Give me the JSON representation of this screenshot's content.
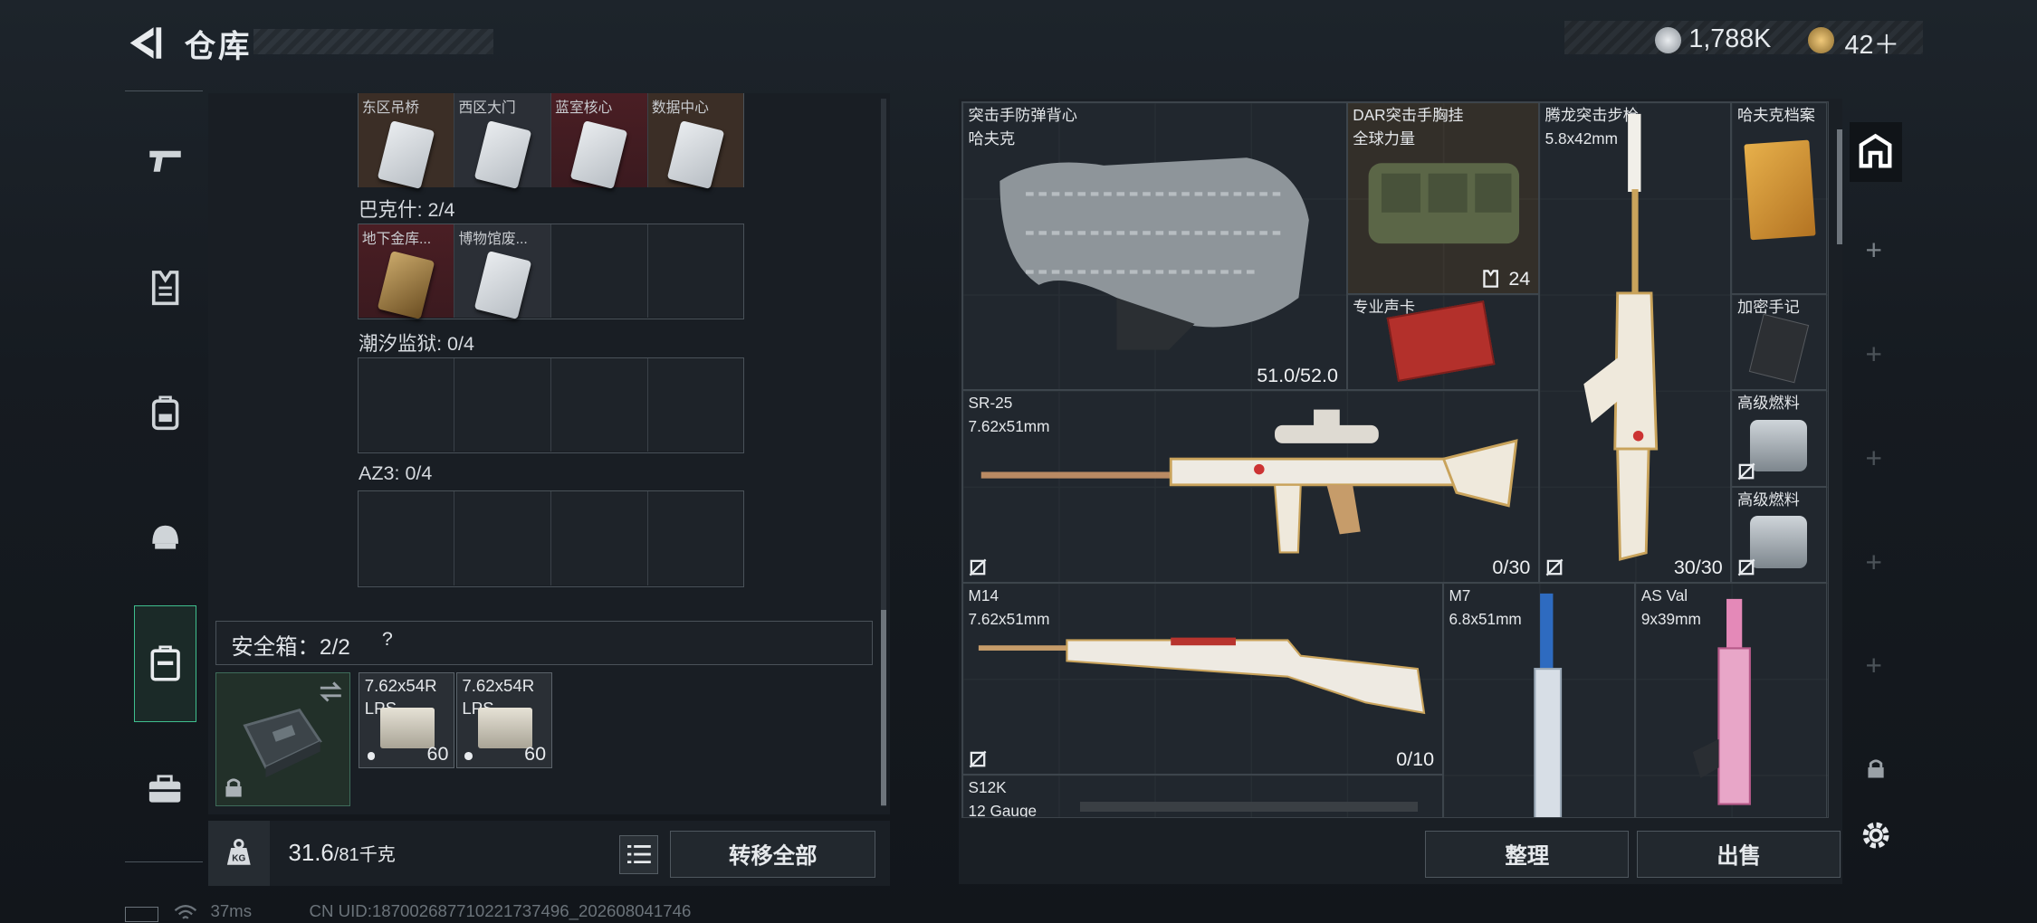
{
  "header": {
    "title": "仓库",
    "currency1": "1,788K",
    "currency2": "42＋"
  },
  "left": {
    "locker_top_row": [
      "东区吊桥",
      "西区大门",
      "蓝室核心",
      "数据中心"
    ],
    "group2_label": "巴克什: 2/4",
    "group2_items": [
      "地下金库...",
      "博物馆废..."
    ],
    "group3_label": "潮汐监狱: 0/4",
    "group4_label": "AZ3: 0/4",
    "safebox_label": "安全箱：2/2",
    "safebox_help": "?",
    "ammo": [
      {
        "name": "7.62x54R",
        "sub": "LPS",
        "count": "60"
      },
      {
        "name": "7.62x54R",
        "sub": "LPS",
        "count": "60"
      }
    ],
    "weight_value": "31.6",
    "weight_limit": "/81千克",
    "transfer_all": "转移全部"
  },
  "stash": {
    "vest": {
      "name": "突击手防弹背心",
      "brand": "哈夫克",
      "durability": "51.0/52.0"
    },
    "rig": {
      "name": "DAR突击手胸挂",
      "brand": "全球力量",
      "count": "24"
    },
    "rifle_tl": {
      "name": "腾龙突击步枪",
      "caliber": "5.8x42mm",
      "ammo": "30/30"
    },
    "havk_file": {
      "name": "哈夫克档案"
    },
    "gpu": {
      "name": "专业声卡"
    },
    "notebook": {
      "name": "加密手记"
    },
    "sr25": {
      "name": "SR-25",
      "caliber": "7.62x51mm",
      "ammo": "0/30"
    },
    "fuel1": {
      "name": "高级燃料"
    },
    "fuel2": {
      "name": "高级燃料"
    },
    "m14": {
      "name": "M14",
      "caliber": "7.62x51mm",
      "ammo": "0/10"
    },
    "m7": {
      "name": "M7",
      "caliber": "6.8x51mm"
    },
    "asval": {
      "name": "AS Val",
      "caliber": "9x39mm"
    },
    "s12k": {
      "name": "S12K",
      "caliber": "12 Gauge"
    },
    "sort_btn": "整理",
    "sell_btn": "出售"
  },
  "footer": {
    "ping": "37ms",
    "uid": "CN UID:18700268771022173749​6_202608041746"
  }
}
